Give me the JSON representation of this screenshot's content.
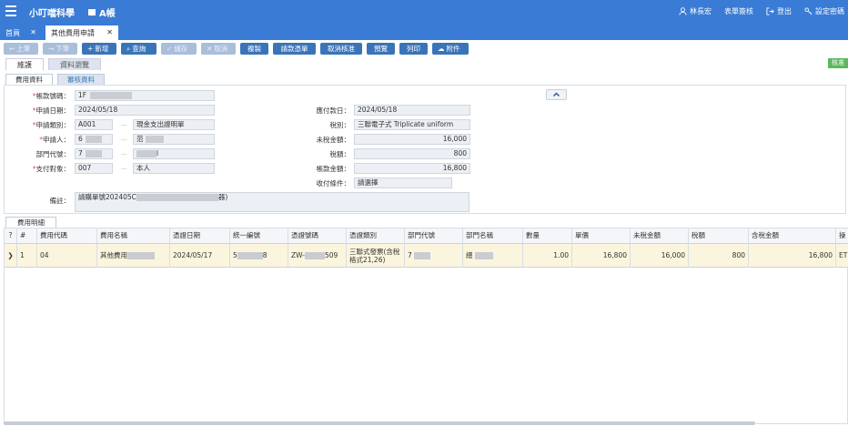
{
  "header": {
    "app_title": "小叮噹科學",
    "book_label": "A帳",
    "user_name": "林長宏",
    "menu_switch": "表單簽核",
    "logout": "登出",
    "settings": "設定密碼"
  },
  "tabs": [
    {
      "label": "首頁"
    },
    {
      "label": "其他費用申請"
    }
  ],
  "toolbar": {
    "prev": "上筆",
    "next": "下筆",
    "add": "新增",
    "query": "查詢",
    "save": "儲存",
    "cancel": "取消",
    "copy": "複製",
    "request_docs": "請款憑單",
    "cancel_approval": "取消核准",
    "preview": "預覽",
    "print": "列印",
    "attach": "附件"
  },
  "approve_badge": "核准",
  "subtabs": {
    "edit": "維護",
    "data_browse": "資料瀏覽"
  },
  "subtabs2": {
    "expense_data": "費用資料",
    "review_data": "審核資料"
  },
  "form": {
    "voucher_no_label": "帳款號碼：",
    "voucher_no_value": "1F",
    "apply_date_label": "申請日期：",
    "apply_date_value": "2024/05/18",
    "due_date_label": "應付款日：",
    "due_date_value": "2024/05/18",
    "apply_type_label": "申請類別：",
    "apply_type_code": "A001",
    "apply_type_name": "現金支出證明單",
    "tax_type_label": "稅別：",
    "tax_type_value": "三聯電子式 Triplicate uniform",
    "applicant_label": "申請人：",
    "applicant_code": "6",
    "applicant_name": "范",
    "untaxed_label": "未稅金額：",
    "untaxed_value": "16,000",
    "dept_label": "部門代號：",
    "dept_code": "7",
    "dept_name": "l",
    "tax_label": "稅額：",
    "tax_value": "800",
    "payee_label": "支付對象：",
    "payee_code": "007",
    "payee_name": "本人",
    "amount_label": "帳款金額：",
    "amount_value": "16,800",
    "terms_label": "收付條件：",
    "terms_value": "請選擇",
    "remark_label": "備註：",
    "remark_value": "請購單號202405C",
    "remark_suffix": "器)"
  },
  "detail_tab": "費用明細",
  "grid": {
    "headers": [
      "?",
      "#",
      "費用代碼",
      "費用名稱",
      "憑證日期",
      "統一編號",
      "憑證號碼",
      "憑證類別",
      "部門代號",
      "部門名稱",
      "數量",
      "單價",
      "未稅金額",
      "稅額",
      "含稅金額",
      "操"
    ],
    "row": {
      "indicator": "❯",
      "index": "1",
      "code": "04",
      "name": "其他費用",
      "date": "2024/05/17",
      "tax_id_a": "5",
      "tax_id_b": "8",
      "voucher_a": "ZW-",
      "voucher_b": "509",
      "voucher_type": "三聯式發票(含稅格式21,26)",
      "dept_code": "7",
      "dept_name": "總",
      "qty": "1.00",
      "price": "16,800",
      "untaxed": "16,000",
      "tax": "800",
      "total": "16,800",
      "op": "ET"
    }
  }
}
